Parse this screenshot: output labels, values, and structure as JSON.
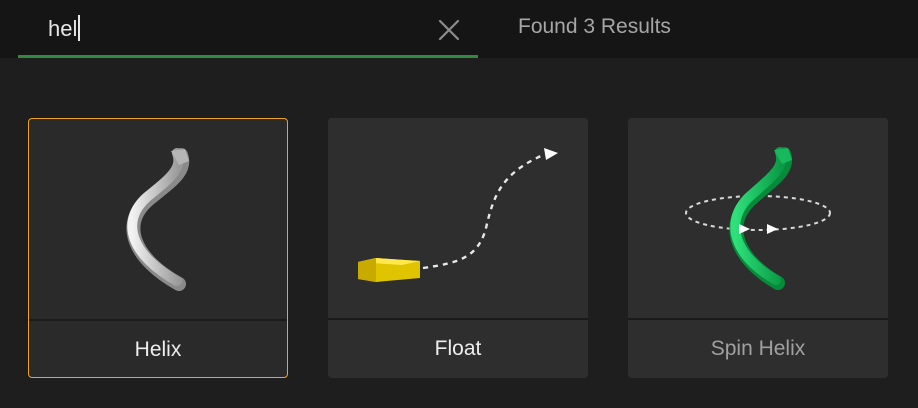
{
  "search": {
    "value": "hel",
    "clear_icon": "close-icon"
  },
  "results": {
    "count_text": "Found 3 Results"
  },
  "colors": {
    "accent_green": "#2f8a3f",
    "selection_orange": "#f0a31c"
  },
  "cards": [
    {
      "label": "Helix",
      "icon": "helix-icon",
      "selected": true
    },
    {
      "label": "Float",
      "icon": "float-path-icon",
      "selected": false
    },
    {
      "label": "Spin Helix",
      "icon": "spin-helix-icon",
      "selected": false
    }
  ]
}
